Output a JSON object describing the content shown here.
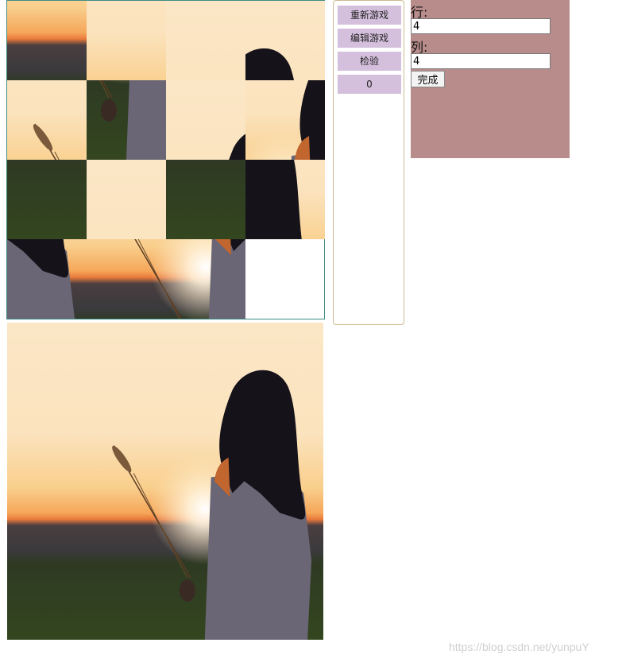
{
  "puzzle": {
    "rows": 4,
    "cols": 4,
    "tile_order": [
      8,
      4,
      0,
      3,
      5,
      14,
      2,
      6,
      12,
      1,
      13,
      7,
      11,
      9,
      10,
      15
    ],
    "empty_tile": 15,
    "border_color": "#3f8c84"
  },
  "controls": {
    "restart_label": "重新游戏",
    "edit_label": "编辑游戏",
    "check_label": "检验",
    "move_count": "0",
    "button_color": "#d4bfdc"
  },
  "settings": {
    "rows_label": "行:",
    "rows_value": "4",
    "cols_label": "列:",
    "cols_value": "4",
    "done_label": "完成",
    "panel_color": "#b98c8c"
  },
  "watermark": "https://blog.csdn.net/yunpuY"
}
